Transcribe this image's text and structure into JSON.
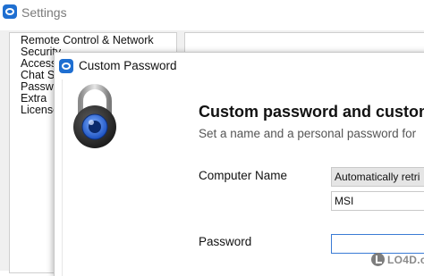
{
  "settings_window": {
    "title": "Settings",
    "nav_items": [
      {
        "label": "Remote Control & Network"
      },
      {
        "label": "Security"
      },
      {
        "label": "Access"
      },
      {
        "label": "Chat Se"
      },
      {
        "label": "Passwo"
      },
      {
        "label": "Extra"
      },
      {
        "label": "License"
      }
    ]
  },
  "dialog": {
    "title": "Custom Password",
    "heading": "Custom password and custom",
    "subheading": "Set a name and a personal password for",
    "computer_name": {
      "label": "Computer Name",
      "mode_value": "Automatically retri",
      "name_value": "MSI"
    },
    "password": {
      "label": "Password",
      "value": ""
    }
  },
  "watermark": {
    "text": "LO4D.com"
  },
  "colors": {
    "accent": "#1f6fd1",
    "input_focus_border": "#3a7bd5",
    "dropdown_bg": "#e5e5e5"
  }
}
